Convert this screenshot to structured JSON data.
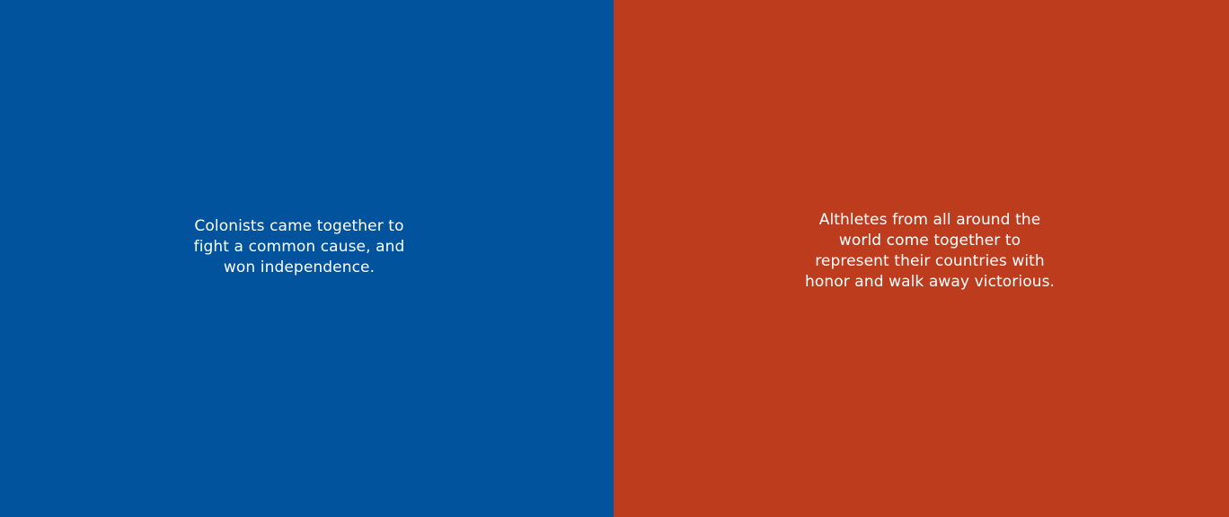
{
  "panels": [
    {
      "color": "#00539c",
      "lines": [
        "Colonists came together to",
        "fight a common cause, and",
        "won independence."
      ]
    },
    {
      "color": "#bd3c1e",
      "lines": [
        "Althletes from all around the",
        "world come together to",
        "represent their countries with",
        "honor and walk away victorious."
      ]
    }
  ]
}
